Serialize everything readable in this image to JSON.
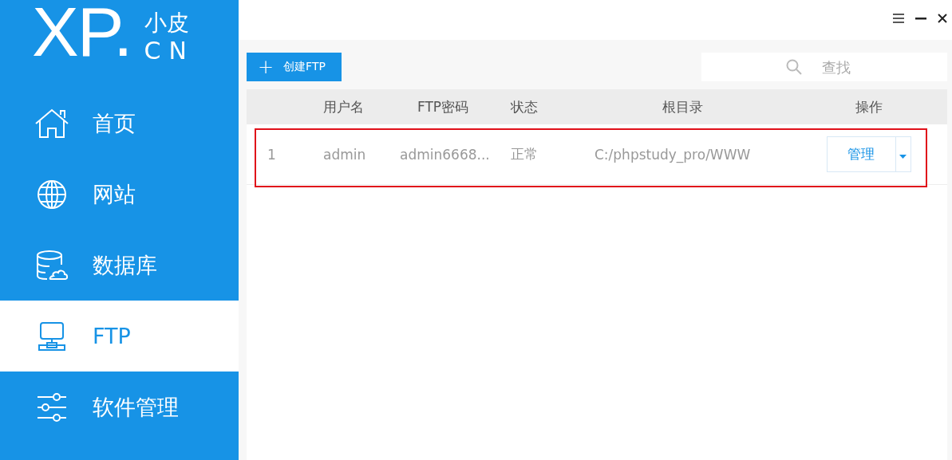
{
  "sidebar": {
    "logo": {
      "mark": "XP.",
      "top": "小皮",
      "bottom": "CN"
    },
    "items": [
      {
        "label": "首页",
        "selected": false
      },
      {
        "label": "网站",
        "selected": false
      },
      {
        "label": "数据库",
        "selected": false
      },
      {
        "label": "FTP",
        "selected": true
      },
      {
        "label": "软件管理",
        "selected": false
      }
    ]
  },
  "toolbar": {
    "create_button": {
      "icon": "+",
      "label": "创建FTP"
    },
    "search": {
      "placeholder": "查找"
    }
  },
  "table": {
    "columns": [
      "",
      "用户名",
      "FTP密码",
      "状态",
      "根目录",
      "操作"
    ],
    "rows": [
      {
        "index": "1",
        "username": "admin",
        "password": "admin6668...",
        "status": "正常",
        "root": "C:/phpstudy_pro/WWW",
        "action": "管理",
        "highlighted": true
      }
    ]
  }
}
